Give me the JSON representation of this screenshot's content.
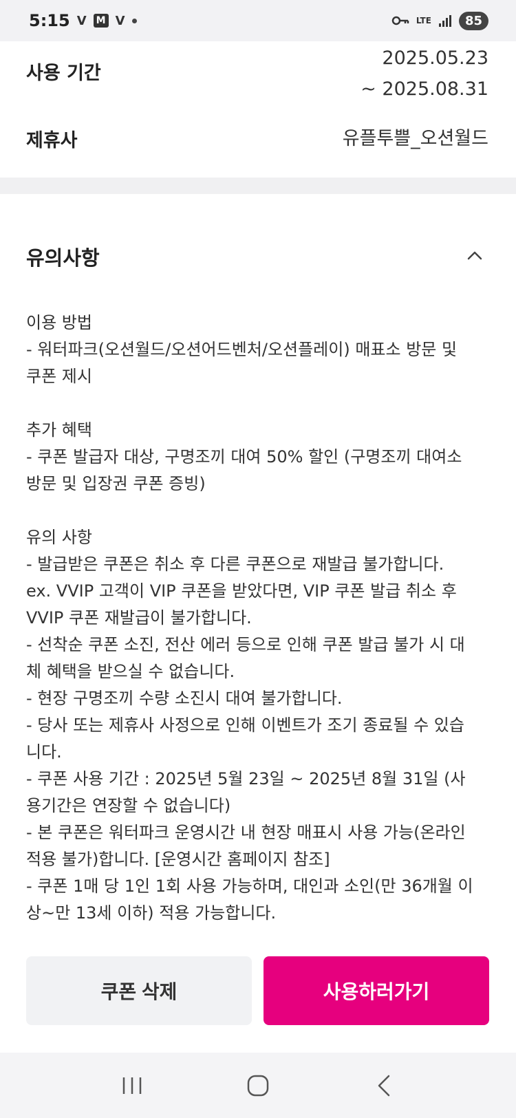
{
  "status_bar": {
    "time": "5:15",
    "icon_v1": "V",
    "icon_m": "M",
    "icon_v2": "V",
    "lte": "LTE",
    "battery": "85"
  },
  "info": {
    "period_label": "사용 기간",
    "period_start": "2025.05.23",
    "period_end": "~ 2025.08.31",
    "partner_label": "제휴사",
    "partner_value": "유플투쁠_오션월드"
  },
  "notice": {
    "title": "유의사항",
    "lines": [
      "이용 방법",
      "- 워터파크(오션월드/오션어드벤처/오션플레이) 매표소 방문 및\n쿠폰 제시",
      "",
      "추가 혜택",
      "- 쿠폰 발급자 대상, 구명조끼 대여 50% 할인 (구명조끼 대여소\n방문 및 입장권 쿠폰 증빙)",
      "",
      "유의 사항",
      "- 발급받은 쿠폰은 취소 후 다른 쿠폰으로 재발급 불가합니다.",
      "ex. VVIP 고객이 VIP 쿠폰을 받았다면, VIP 쿠폰 발급 취소 후\nVVIP 쿠폰 재발급이 불가합니다.",
      "- 선착순 쿠폰 소진, 전산 에러 등으로 인해 쿠폰 발급 불가 시 대\n체 혜택을 받으실 수 없습니다.",
      "- 현장 구명조끼 수량 소진시 대여 불가합니다.",
      "- 당사 또는 제휴사 사정으로 인해 이벤트가 조기 종료될 수 있습\n니다.",
      "- 쿠폰 사용 기간 : 2025년 5월 23일 ~ 2025년 8월 31일 (사\n용기간은 연장할 수 없습니다)",
      "- 본 쿠폰은 워터파크 운영시간 내 현장 매표시 사용 가능(온라인\n적용 불가)합니다. [운영시간 홈페이지 참조]",
      "- 쿠폰 1매 당 1인 1회 사용 가능하며, 대인과 소인(만 36개월 이\n상~만 13세 이하) 적용 가능합니다."
    ]
  },
  "buttons": {
    "delete": "쿠폰 삭제",
    "use": "사용하러가기"
  },
  "colors": {
    "accent": "#e6007e",
    "secondary_button": "#f1f2f4"
  },
  "icons": {
    "chevron": "chevron-up-icon",
    "nav_recent": "recent-apps-icon",
    "nav_home": "home-icon",
    "nav_back": "back-icon"
  }
}
